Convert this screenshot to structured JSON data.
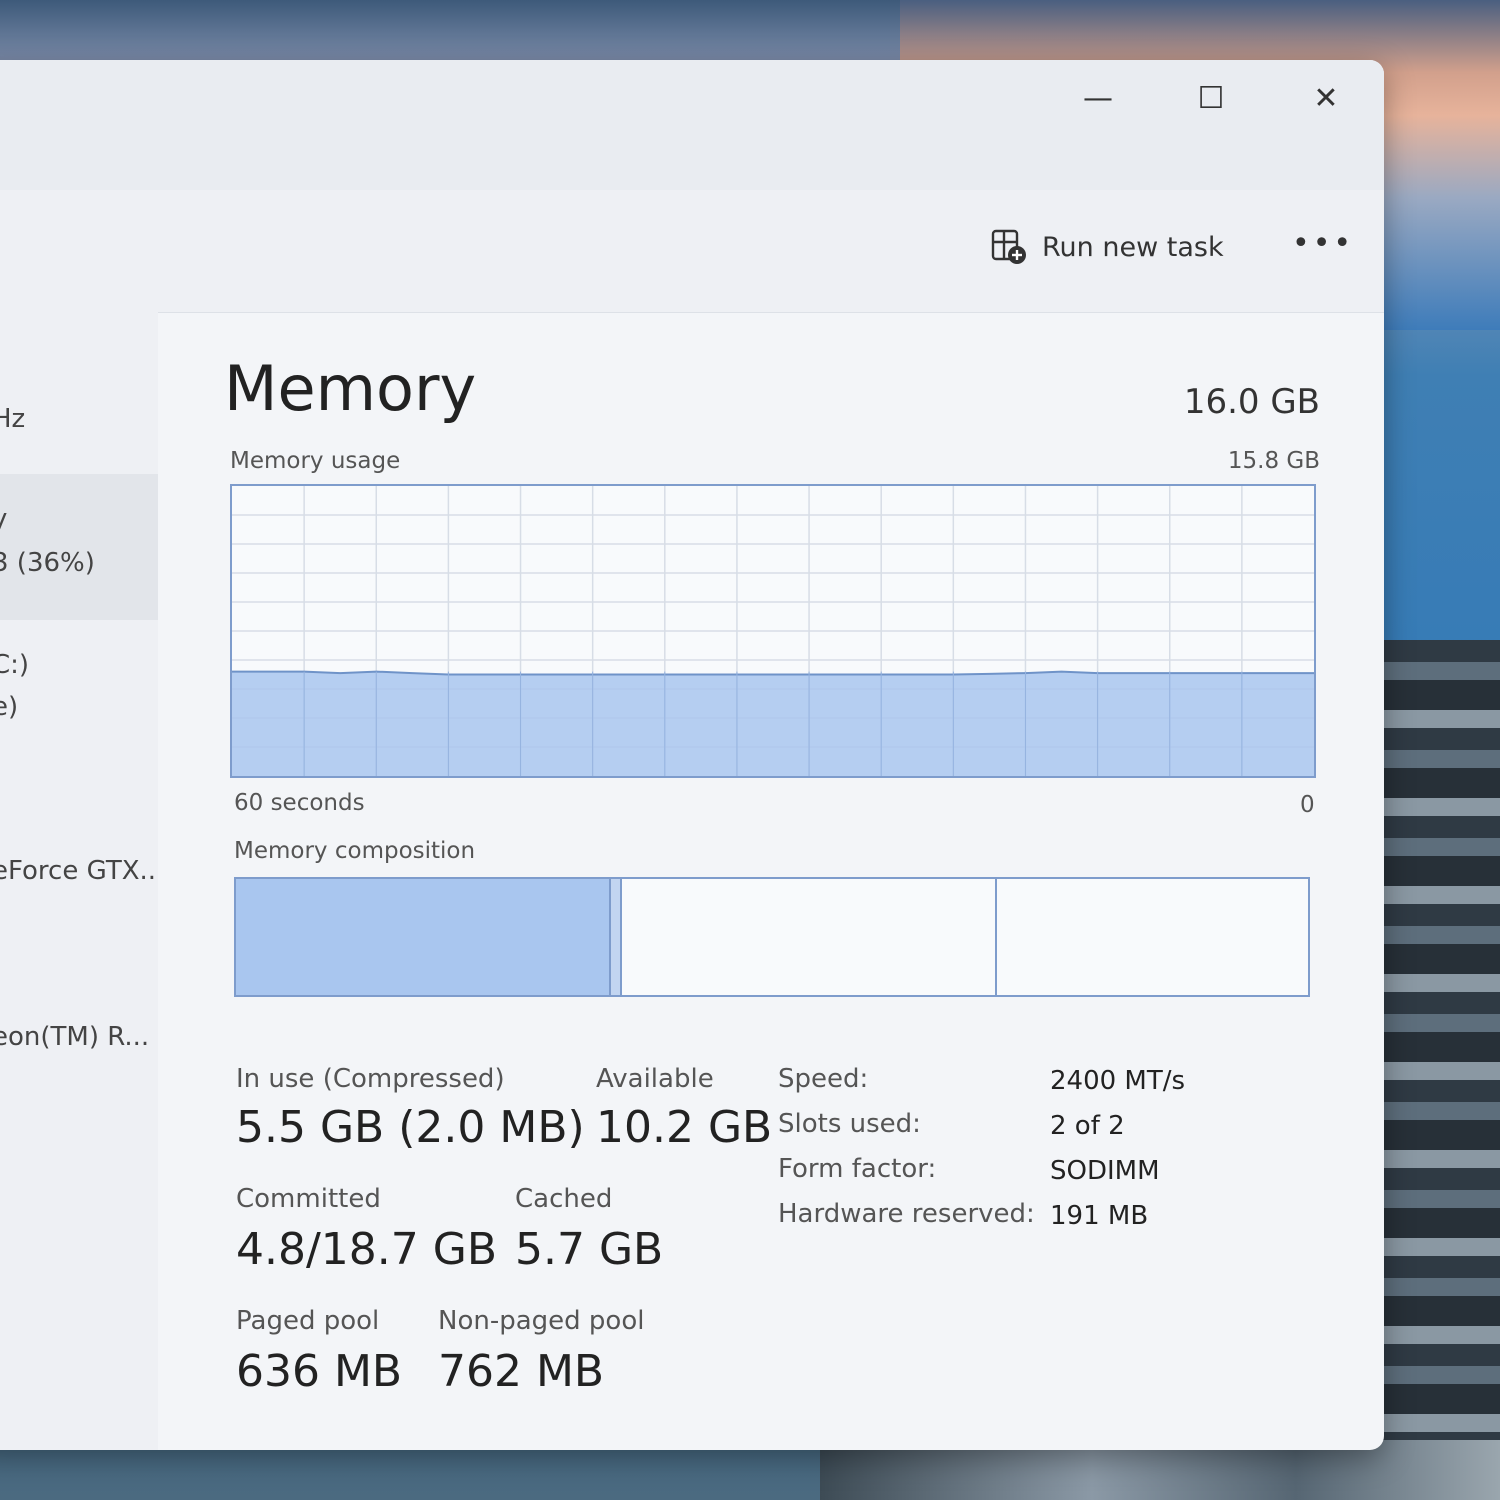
{
  "window": {
    "controls": {
      "minimize": "—",
      "maximize": "☐",
      "close": "✕"
    }
  },
  "toolbar": {
    "run_new_task": "Run new task",
    "more": "•••",
    "run_icon": "run-task-icon"
  },
  "sidebar": {
    "items": [
      {
        "line1": "Hz"
      },
      {
        "line1": "y",
        "line2": "3 (36%)",
        "selected": true
      },
      {
        "line1": "C:)",
        "line2": "e)"
      },
      {
        "line1": "eForce GTX...",
        "line2": ")"
      },
      {
        "line1": "eon(TM) R...",
        "line2": ")"
      }
    ]
  },
  "memory": {
    "title": "Memory",
    "total": "16.0 GB",
    "usage_label": "Memory usage",
    "usage_max": "15.8 GB",
    "time_left": "60 seconds",
    "time_right": "0",
    "composition_label": "Memory composition",
    "graph_usage_fraction": [
      0.36,
      0.36,
      0.36,
      0.355,
      0.36,
      0.355,
      0.35,
      0.35,
      0.35,
      0.35,
      0.35,
      0.35,
      0.35,
      0.35,
      0.35,
      0.35,
      0.35,
      0.35,
      0.35,
      0.35,
      0.35,
      0.352,
      0.355,
      0.36,
      0.355,
      0.355,
      0.355,
      0.355,
      0.355,
      0.355,
      0.355
    ],
    "composition": {
      "in_use_fraction": 0.35,
      "modified_fraction": 0.01,
      "standby_fraction": 0.35
    },
    "colors": {
      "fill": "#a9c6ef",
      "line": "#6f93c8",
      "grid": "#d7dde6"
    },
    "stats": {
      "in_use_label": "In use (Compressed)",
      "in_use_value": "5.5 GB (2.0 MB)",
      "available_label": "Available",
      "available_value": "10.2 GB",
      "committed_label": "Committed",
      "committed_value": "4.8/18.7 GB",
      "cached_label": "Cached",
      "cached_value": "5.7 GB",
      "paged_label": "Paged pool",
      "paged_value": "636 MB",
      "nonpaged_label": "Non-paged pool",
      "nonpaged_value": "762 MB"
    },
    "specs": {
      "speed_label": "Speed:",
      "speed_value": "2400 MT/s",
      "slots_label": "Slots used:",
      "slots_value": "2 of 2",
      "form_label": "Form factor:",
      "form_value": "SODIMM",
      "hw_label": "Hardware reserved:",
      "hw_value": "191 MB"
    }
  }
}
